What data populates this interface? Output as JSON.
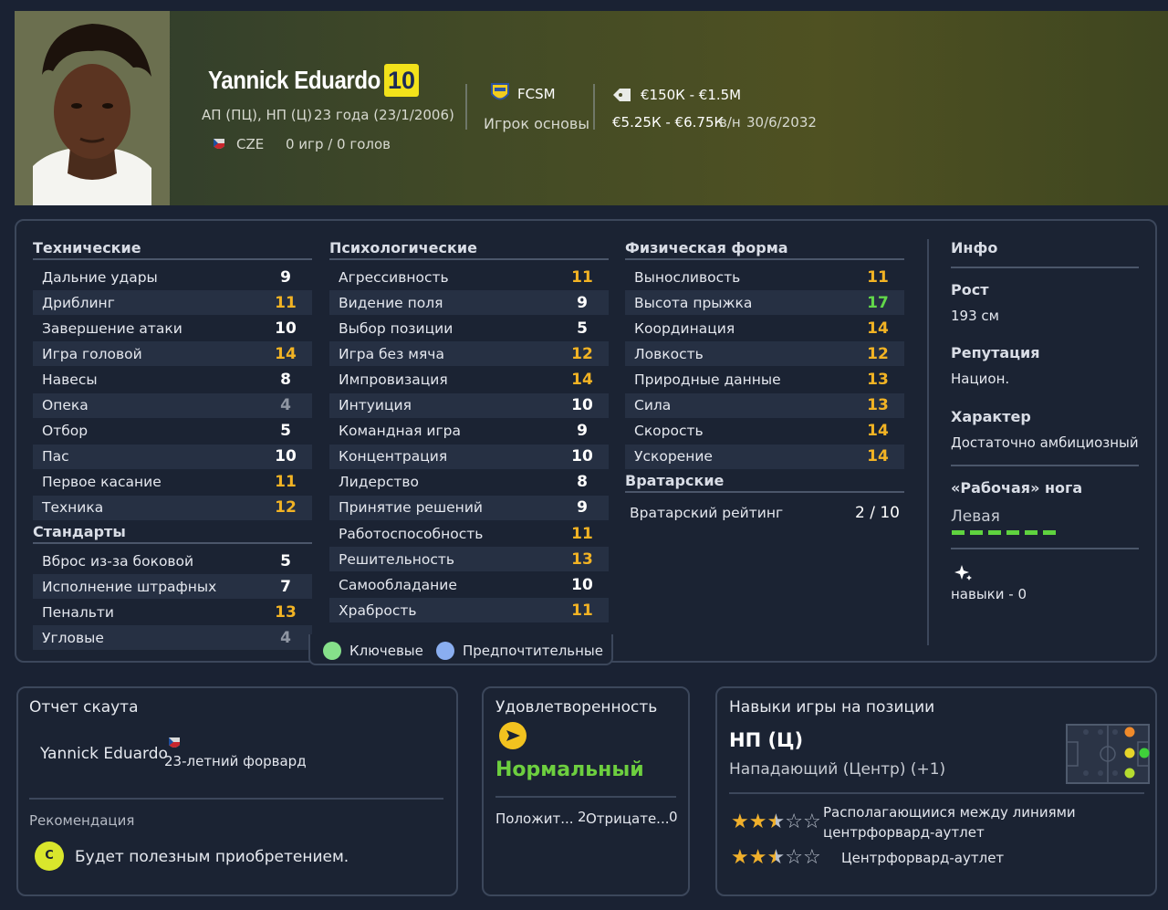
{
  "player": {
    "name": "Yannick Eduardo",
    "number": "10",
    "positions": "АП (ПЦ), НП (Ц)",
    "age_text": "23 года (23/1/2006)",
    "nation": "CZE",
    "games": "0 игр / 0 голов"
  },
  "club": {
    "name": "FCSM",
    "status": "Игрок основы"
  },
  "contract": {
    "value": "€150К - €1.5M",
    "wage": "€5.25К - €6.75К",
    "wage_unit": "в/н",
    "expires": "30/6/2032"
  },
  "sections": {
    "technical": {
      "title": "Технические",
      "rows": [
        {
          "label": "Дальние удары",
          "value": "9"
        },
        {
          "label": "Дриблинг",
          "value": "11"
        },
        {
          "label": "Завершение атаки",
          "value": "10"
        },
        {
          "label": "Игра головой",
          "value": "14"
        },
        {
          "label": "Навесы",
          "value": "8"
        },
        {
          "label": "Опека",
          "value": "4"
        },
        {
          "label": "Отбор",
          "value": "5"
        },
        {
          "label": "Пас",
          "value": "10"
        },
        {
          "label": "Первое касание",
          "value": "11"
        },
        {
          "label": "Техника",
          "value": "12"
        }
      ]
    },
    "setpieces": {
      "title": "Стандарты",
      "rows": [
        {
          "label": "Вброс из-за боковой",
          "value": "5"
        },
        {
          "label": "Исполнение штрафных",
          "value": "7"
        },
        {
          "label": "Пенальти",
          "value": "13"
        },
        {
          "label": "Угловые",
          "value": "4"
        }
      ]
    },
    "mental": {
      "title": "Психологические",
      "rows": [
        {
          "label": "Агрессивность",
          "value": "11"
        },
        {
          "label": "Видение поля",
          "value": "9"
        },
        {
          "label": "Выбор позиции",
          "value": "5"
        },
        {
          "label": "Игра без мяча",
          "value": "12"
        },
        {
          "label": "Импровизация",
          "value": "14"
        },
        {
          "label": "Интуиция",
          "value": "10"
        },
        {
          "label": "Командная игра",
          "value": "9"
        },
        {
          "label": "Концентрация",
          "value": "10"
        },
        {
          "label": "Лидерство",
          "value": "8"
        },
        {
          "label": "Принятие решений",
          "value": "9"
        },
        {
          "label": "Работоспособность",
          "value": "11"
        },
        {
          "label": "Решительность",
          "value": "13"
        },
        {
          "label": "Самообладание",
          "value": "10"
        },
        {
          "label": "Храбрость",
          "value": "11"
        }
      ]
    },
    "physical": {
      "title": "Физическая форма",
      "rows": [
        {
          "label": "Выносливость",
          "value": "11"
        },
        {
          "label": "Высота прыжка",
          "value": "17"
        },
        {
          "label": "Координация",
          "value": "14"
        },
        {
          "label": "Ловкость",
          "value": "12"
        },
        {
          "label": "Природные данные",
          "value": "13"
        },
        {
          "label": "Сила",
          "value": "13"
        },
        {
          "label": "Скорость",
          "value": "14"
        },
        {
          "label": "Ускорение",
          "value": "14"
        }
      ]
    },
    "goalkeeping": {
      "title": "Вратарские",
      "label": "Вратарский рейтинг",
      "value": "2 / 10"
    }
  },
  "info": {
    "title": "Инфо",
    "height_label": "Рост",
    "height_value": "193 см",
    "reputation_label": "Репутация",
    "reputation_value": "Национ.",
    "character_label": "Характер",
    "character_value": "Достаточно амбициозный",
    "foot_label": "«Рабочая» нога",
    "foot_value": "Левая",
    "foot_level": 1.0,
    "skills_text": "навыки - 0"
  },
  "legend": {
    "key": "Ключевые",
    "preferred": "Предпочтительные"
  },
  "scout": {
    "title": "Отчет скаута",
    "name": "Yannick Eduardo",
    "desc": "23-летний форвард",
    "recommend_label": "Рекомендация",
    "grade": "C",
    "recommend_text": "Будет полезным приобретением."
  },
  "satisfaction": {
    "title": "Удовлетворенность",
    "status": "Нормальный",
    "pos_label": "Положит...",
    "pos_value": "2",
    "neg_label": "Отрицате...",
    "neg_value": "0"
  },
  "position": {
    "title": "Навыки игры на позиции",
    "code": "НП (Ц)",
    "name": "Нападающий (Центр) (+1)",
    "roles": [
      {
        "label_line1": "Располагающиися между линиями",
        "label_line2": "центрфорвард-аутлет",
        "stars": 2.5
      },
      {
        "label_line1": "Центрфорвард-аутлет",
        "label_line2": "",
        "stars": 2.5
      }
    ]
  },
  "colors": {
    "value_high": "#f2b324",
    "value_green": "#62d84a",
    "value_white": "#ffffff",
    "value_grey": "#8f96a3",
    "accent_green": "#5fd33f",
    "badge_yellow": "#f2e21a"
  }
}
